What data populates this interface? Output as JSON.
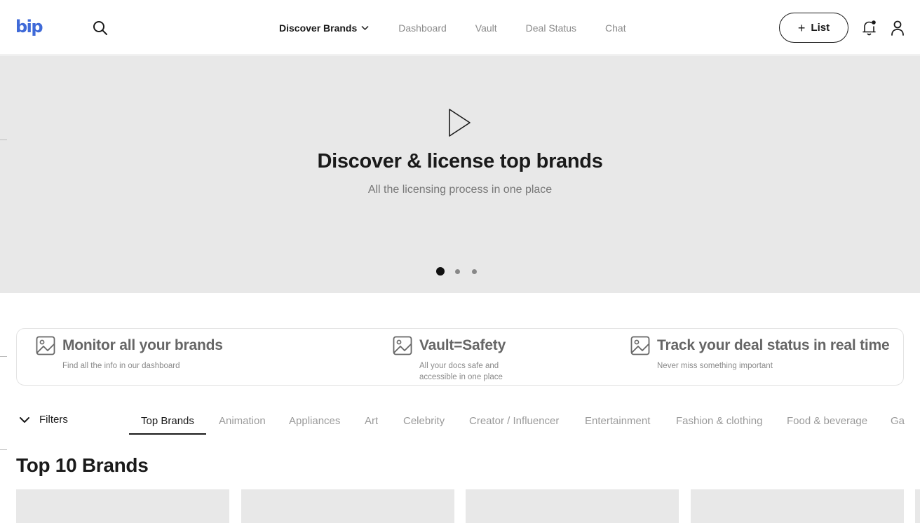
{
  "header": {
    "logo": "bip",
    "nav": {
      "discover": "Discover Brands",
      "dashboard": "Dashboard",
      "vault": "Vault",
      "deal_status": "Deal Status",
      "chat": "Chat"
    },
    "list_button": {
      "plus": "+",
      "label": "List"
    },
    "icons": [
      "search-icon",
      "chevron-down-icon",
      "bell-icon",
      "user-icon"
    ]
  },
  "hero": {
    "title": "Discover & license top brands",
    "subtitle": "All the licensing process in one place",
    "carousel": {
      "count": 3,
      "active_index": 0
    },
    "icon": "play-icon"
  },
  "features": [
    {
      "title": "Monitor all your brands",
      "description": "Find all the info in our dashboard",
      "icon": "image-icon"
    },
    {
      "title": "Vault=Safety",
      "description_line1": "All your docs safe and",
      "description_line2": "accessible in one place",
      "icon": "image-icon"
    },
    {
      "title": "Track your deal status in real time",
      "description": "Never miss something important",
      "icon": "image-icon"
    }
  ],
  "filters": {
    "label": "Filters"
  },
  "categories": {
    "active": "Top Brands",
    "items": [
      "Top Brands",
      "Animation",
      "Appliances",
      "Art",
      "Celebrity",
      "Creator / Influencer",
      "Entertainment",
      "Fashion & clothing",
      "Food & beverage",
      "Ga"
    ]
  },
  "section": {
    "title": "Top 10 Brands"
  },
  "colors": {
    "brand": "#3f6ad8",
    "hero_bg": "#e8e8e8",
    "text_primary": "#1a1a1a",
    "text_muted": "#8a8a8a"
  }
}
